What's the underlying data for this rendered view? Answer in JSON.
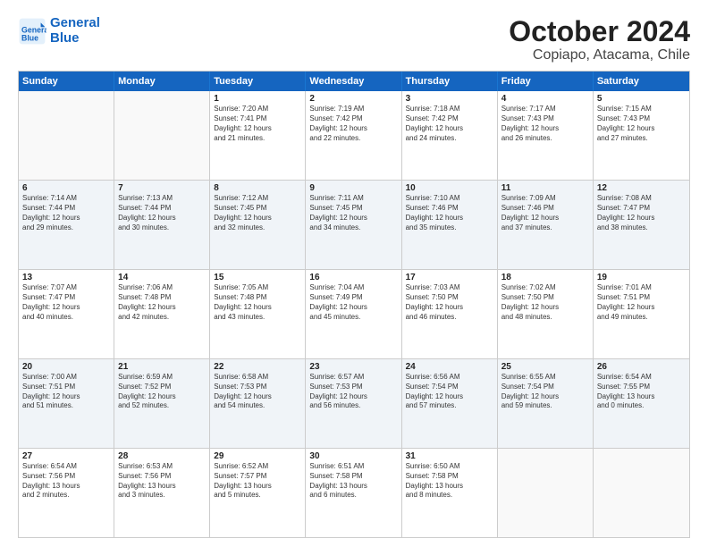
{
  "logo": {
    "line1": "General",
    "line2": "Blue"
  },
  "title": "October 2024",
  "subtitle": "Copiapo, Atacama, Chile",
  "weekdays": [
    "Sunday",
    "Monday",
    "Tuesday",
    "Wednesday",
    "Thursday",
    "Friday",
    "Saturday"
  ],
  "rows": [
    [
      {
        "day": "",
        "info": ""
      },
      {
        "day": "",
        "info": ""
      },
      {
        "day": "1",
        "info": "Sunrise: 7:20 AM\nSunset: 7:41 PM\nDaylight: 12 hours\nand 21 minutes."
      },
      {
        "day": "2",
        "info": "Sunrise: 7:19 AM\nSunset: 7:42 PM\nDaylight: 12 hours\nand 22 minutes."
      },
      {
        "day": "3",
        "info": "Sunrise: 7:18 AM\nSunset: 7:42 PM\nDaylight: 12 hours\nand 24 minutes."
      },
      {
        "day": "4",
        "info": "Sunrise: 7:17 AM\nSunset: 7:43 PM\nDaylight: 12 hours\nand 26 minutes."
      },
      {
        "day": "5",
        "info": "Sunrise: 7:15 AM\nSunset: 7:43 PM\nDaylight: 12 hours\nand 27 minutes."
      }
    ],
    [
      {
        "day": "6",
        "info": "Sunrise: 7:14 AM\nSunset: 7:44 PM\nDaylight: 12 hours\nand 29 minutes."
      },
      {
        "day": "7",
        "info": "Sunrise: 7:13 AM\nSunset: 7:44 PM\nDaylight: 12 hours\nand 30 minutes."
      },
      {
        "day": "8",
        "info": "Sunrise: 7:12 AM\nSunset: 7:45 PM\nDaylight: 12 hours\nand 32 minutes."
      },
      {
        "day": "9",
        "info": "Sunrise: 7:11 AM\nSunset: 7:45 PM\nDaylight: 12 hours\nand 34 minutes."
      },
      {
        "day": "10",
        "info": "Sunrise: 7:10 AM\nSunset: 7:46 PM\nDaylight: 12 hours\nand 35 minutes."
      },
      {
        "day": "11",
        "info": "Sunrise: 7:09 AM\nSunset: 7:46 PM\nDaylight: 12 hours\nand 37 minutes."
      },
      {
        "day": "12",
        "info": "Sunrise: 7:08 AM\nSunset: 7:47 PM\nDaylight: 12 hours\nand 38 minutes."
      }
    ],
    [
      {
        "day": "13",
        "info": "Sunrise: 7:07 AM\nSunset: 7:47 PM\nDaylight: 12 hours\nand 40 minutes."
      },
      {
        "day": "14",
        "info": "Sunrise: 7:06 AM\nSunset: 7:48 PM\nDaylight: 12 hours\nand 42 minutes."
      },
      {
        "day": "15",
        "info": "Sunrise: 7:05 AM\nSunset: 7:48 PM\nDaylight: 12 hours\nand 43 minutes."
      },
      {
        "day": "16",
        "info": "Sunrise: 7:04 AM\nSunset: 7:49 PM\nDaylight: 12 hours\nand 45 minutes."
      },
      {
        "day": "17",
        "info": "Sunrise: 7:03 AM\nSunset: 7:50 PM\nDaylight: 12 hours\nand 46 minutes."
      },
      {
        "day": "18",
        "info": "Sunrise: 7:02 AM\nSunset: 7:50 PM\nDaylight: 12 hours\nand 48 minutes."
      },
      {
        "day": "19",
        "info": "Sunrise: 7:01 AM\nSunset: 7:51 PM\nDaylight: 12 hours\nand 49 minutes."
      }
    ],
    [
      {
        "day": "20",
        "info": "Sunrise: 7:00 AM\nSunset: 7:51 PM\nDaylight: 12 hours\nand 51 minutes."
      },
      {
        "day": "21",
        "info": "Sunrise: 6:59 AM\nSunset: 7:52 PM\nDaylight: 12 hours\nand 52 minutes."
      },
      {
        "day": "22",
        "info": "Sunrise: 6:58 AM\nSunset: 7:53 PM\nDaylight: 12 hours\nand 54 minutes."
      },
      {
        "day": "23",
        "info": "Sunrise: 6:57 AM\nSunset: 7:53 PM\nDaylight: 12 hours\nand 56 minutes."
      },
      {
        "day": "24",
        "info": "Sunrise: 6:56 AM\nSunset: 7:54 PM\nDaylight: 12 hours\nand 57 minutes."
      },
      {
        "day": "25",
        "info": "Sunrise: 6:55 AM\nSunset: 7:54 PM\nDaylight: 12 hours\nand 59 minutes."
      },
      {
        "day": "26",
        "info": "Sunrise: 6:54 AM\nSunset: 7:55 PM\nDaylight: 13 hours\nand 0 minutes."
      }
    ],
    [
      {
        "day": "27",
        "info": "Sunrise: 6:54 AM\nSunset: 7:56 PM\nDaylight: 13 hours\nand 2 minutes."
      },
      {
        "day": "28",
        "info": "Sunrise: 6:53 AM\nSunset: 7:56 PM\nDaylight: 13 hours\nand 3 minutes."
      },
      {
        "day": "29",
        "info": "Sunrise: 6:52 AM\nSunset: 7:57 PM\nDaylight: 13 hours\nand 5 minutes."
      },
      {
        "day": "30",
        "info": "Sunrise: 6:51 AM\nSunset: 7:58 PM\nDaylight: 13 hours\nand 6 minutes."
      },
      {
        "day": "31",
        "info": "Sunrise: 6:50 AM\nSunset: 7:58 PM\nDaylight: 13 hours\nand 8 minutes."
      },
      {
        "day": "",
        "info": ""
      },
      {
        "day": "",
        "info": ""
      }
    ]
  ]
}
